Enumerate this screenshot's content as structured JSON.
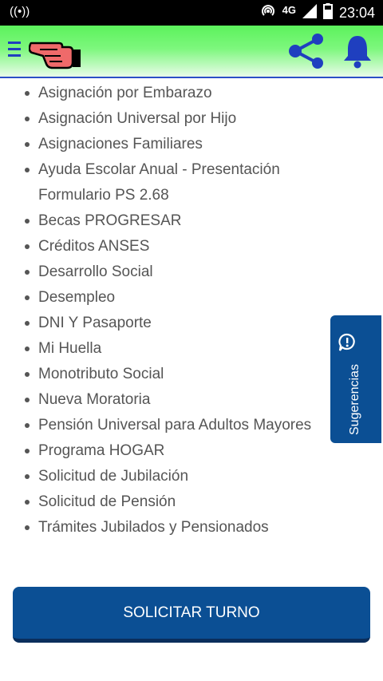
{
  "status_bar": {
    "network_type": "4G",
    "time": "23:04"
  },
  "app_bar": {
    "menu_icon": "hamburger-menu-icon",
    "mascot_icon": "pointing-hand-icon",
    "share_icon": "share-icon",
    "bell_icon": "notification-bell-icon",
    "accent_color": "#1f3fbf"
  },
  "topics": [
    "Asignación por Embarazo",
    "Asignación Universal por Hijo",
    "Asignaciones Familiares",
    "Ayuda Escolar Anual - Presentación Formulario PS 2.68",
    "Becas PROGRESAR",
    "Créditos ANSES",
    "Desarrollo Social",
    "Desempleo",
    "DNI Y Pasaporte",
    "Mi Huella",
    "Monotributo Social",
    "Nueva Moratoria",
    "Pensión Universal para Adultos Mayores",
    "Programa HOGAR",
    "Solicitud de Jubilación",
    "Solicitud de Pensión",
    "Trámites Jubilados y Pensionados"
  ],
  "suggestions_tab": {
    "label": "Sugerencias",
    "icon": "chat-info-icon"
  },
  "primary_button": {
    "label": "SOLICITAR TURNO",
    "color": "#0b4f94"
  }
}
